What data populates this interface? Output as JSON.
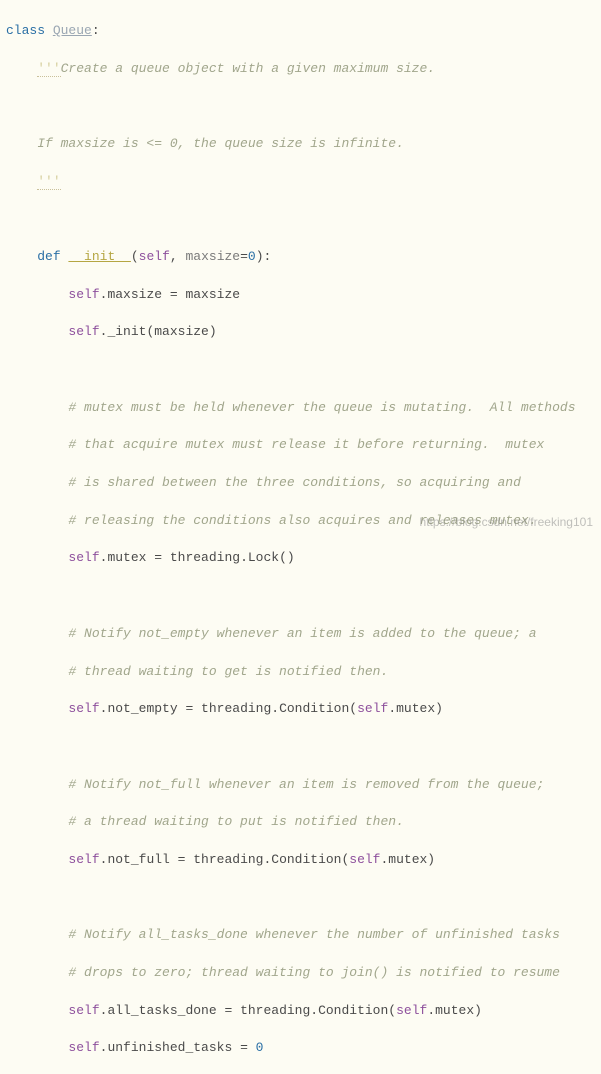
{
  "code": {
    "kw_class": "class",
    "classname": "Queue",
    "colon": ":",
    "doc_open": "'''",
    "doc_line1": "Create a queue object with a given maximum size.",
    "doc_blank": "",
    "doc_line2": "If maxsize is <= 0, the queue size is infinite.",
    "doc_close": "'''",
    "kw_def": "def",
    "funcname": "__init__",
    "paren_open": "(",
    "self": "self",
    "comma": ", ",
    "param_maxsize": "maxsize",
    "eq": "=",
    "zero": "0",
    "paren_close_colon": "):",
    "body_line1_a": ".maxsize = maxsize",
    "body_line2_a": "._init(maxsize)",
    "cmt_mutex1": "# mutex must be held whenever the queue is mutating.  All methods",
    "cmt_mutex2": "# that acquire mutex must release it before returning.  mutex",
    "cmt_mutex3": "# is shared between the three conditions, so acquiring and",
    "cmt_mutex4": "# releasing the conditions also acquires and releases mutex.",
    "stmt_mutex": ".mutex = threading.Lock()",
    "cmt_ne1": "# Notify not_empty whenever an item is added to the queue; a",
    "cmt_ne2": "# thread waiting to get is notified then.",
    "stmt_ne_a": ".not_empty = threading.Condition(",
    "stmt_ne_b": ".mutex)",
    "cmt_nf1": "# Notify not_full whenever an item is removed from the queue;",
    "cmt_nf2": "# a thread waiting to put is notified then.",
    "stmt_nf_a": ".not_full = threading.Condition(",
    "stmt_nf_b": ".mutex)",
    "cmt_atd1": "# Notify all_tasks_done whenever the number of unfinished tasks",
    "cmt_atd2": "# drops to zero; thread waiting to join() is notified to resume",
    "stmt_atd_a": ".all_tasks_done = threading.Condition(",
    "stmt_atd_b": ".mutex)",
    "stmt_unf_a": ".unfinished_tasks = ",
    "stmt_unf_num": "0"
  },
  "watermark": "https://blog.csdn.net/freeking101"
}
